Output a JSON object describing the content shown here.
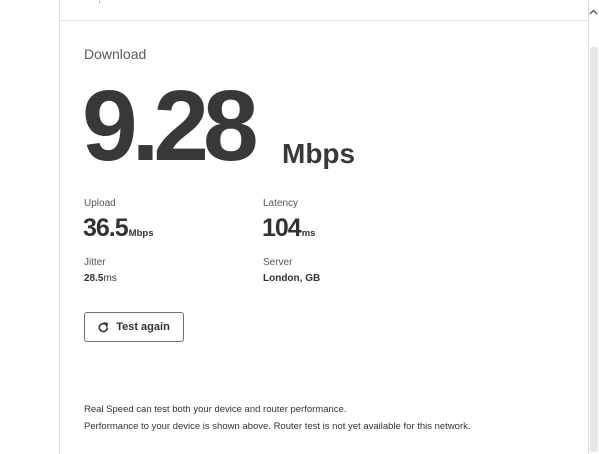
{
  "download": {
    "label": "Download",
    "value": "9.28",
    "unit": "Mbps"
  },
  "upload": {
    "label": "Upload",
    "value": "36.5",
    "unit": "Mbps"
  },
  "latency": {
    "label": "Latency",
    "value": "104",
    "unit": "ms"
  },
  "jitter": {
    "label": "Jitter",
    "value": "28.5",
    "unit": "ms"
  },
  "server": {
    "label": "Server",
    "value": "London, GB"
  },
  "actions": {
    "test_again": "Test again"
  },
  "info": {
    "line1": "Real Speed can test both your device and router performance.",
    "line2": "Performance to your device is shown above. Router test is not yet available for this network."
  },
  "icons": {
    "retry": "refresh-icon",
    "scroll": "chevron-up-icon"
  }
}
